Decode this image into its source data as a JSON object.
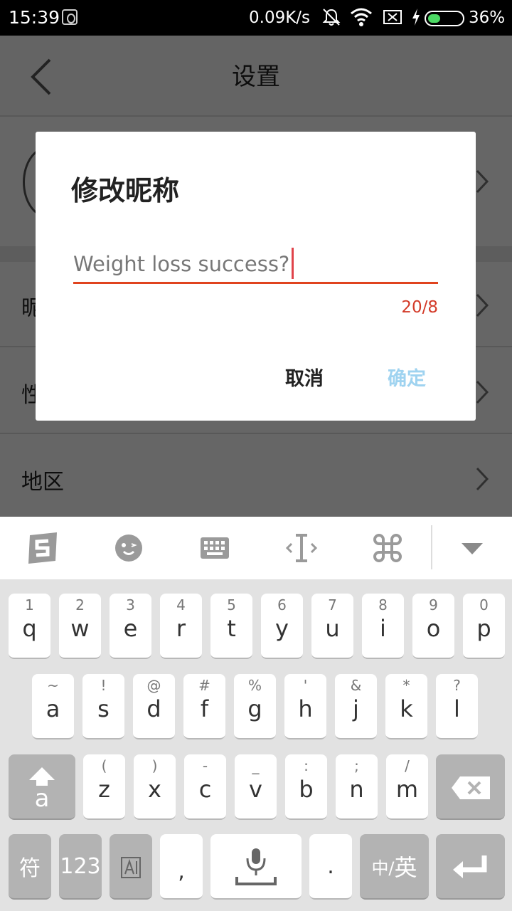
{
  "status_bar": {
    "time": "15:39",
    "network_speed": "0.09K/s",
    "battery_percent": "36%",
    "battery_level": 0.36,
    "icons": [
      "app-icon",
      "bell-muted-icon",
      "wifi-icon",
      "sim-disabled-icon",
      "charging-icon",
      "battery-icon"
    ]
  },
  "header": {
    "title": "设置",
    "back_icon": "chevron-left-icon"
  },
  "settings": {
    "rows": [
      {
        "label": "昵称"
      },
      {
        "label": "性别"
      },
      {
        "label": "地区"
      }
    ]
  },
  "dialog": {
    "title": "修改昵称",
    "input_value": "Weight loss success?",
    "counter": "20/8",
    "cancel_label": "取消",
    "confirm_label": "确定",
    "accent_color": "#e0431e",
    "confirm_color": "#9fd3f0"
  },
  "keyboard": {
    "toolbar_icons": [
      "sogou-logo-icon",
      "emoji-icon",
      "keyboard-icon",
      "cursor-move-icon",
      "command-icon",
      "collapse-icon"
    ],
    "row1": [
      {
        "main": "q",
        "sub": "1"
      },
      {
        "main": "w",
        "sub": "2"
      },
      {
        "main": "e",
        "sub": "3"
      },
      {
        "main": "r",
        "sub": "4"
      },
      {
        "main": "t",
        "sub": "5"
      },
      {
        "main": "y",
        "sub": "6"
      },
      {
        "main": "u",
        "sub": "7"
      },
      {
        "main": "i",
        "sub": "8"
      },
      {
        "main": "o",
        "sub": "9"
      },
      {
        "main": "p",
        "sub": "0"
      }
    ],
    "row2": [
      {
        "main": "a",
        "sub": "~"
      },
      {
        "main": "s",
        "sub": "!"
      },
      {
        "main": "d",
        "sub": "@"
      },
      {
        "main": "f",
        "sub": "#"
      },
      {
        "main": "g",
        "sub": "%"
      },
      {
        "main": "h",
        "sub": "'"
      },
      {
        "main": "j",
        "sub": "&"
      },
      {
        "main": "k",
        "sub": "*"
      },
      {
        "main": "l",
        "sub": "?"
      }
    ],
    "row3": [
      {
        "main": "z",
        "sub": "("
      },
      {
        "main": "x",
        "sub": ")"
      },
      {
        "main": "c",
        "sub": "-"
      },
      {
        "main": "v",
        "sub": "_"
      },
      {
        "main": "b",
        "sub": ":"
      },
      {
        "main": "n",
        "sub": ";"
      },
      {
        "main": "m",
        "sub": "/"
      }
    ],
    "shift_letter": "a",
    "symbols_label": "符",
    "numbers_label": "123",
    "comma": ",",
    "period": ".",
    "lang_zh": "中/",
    "lang_en": "英"
  }
}
